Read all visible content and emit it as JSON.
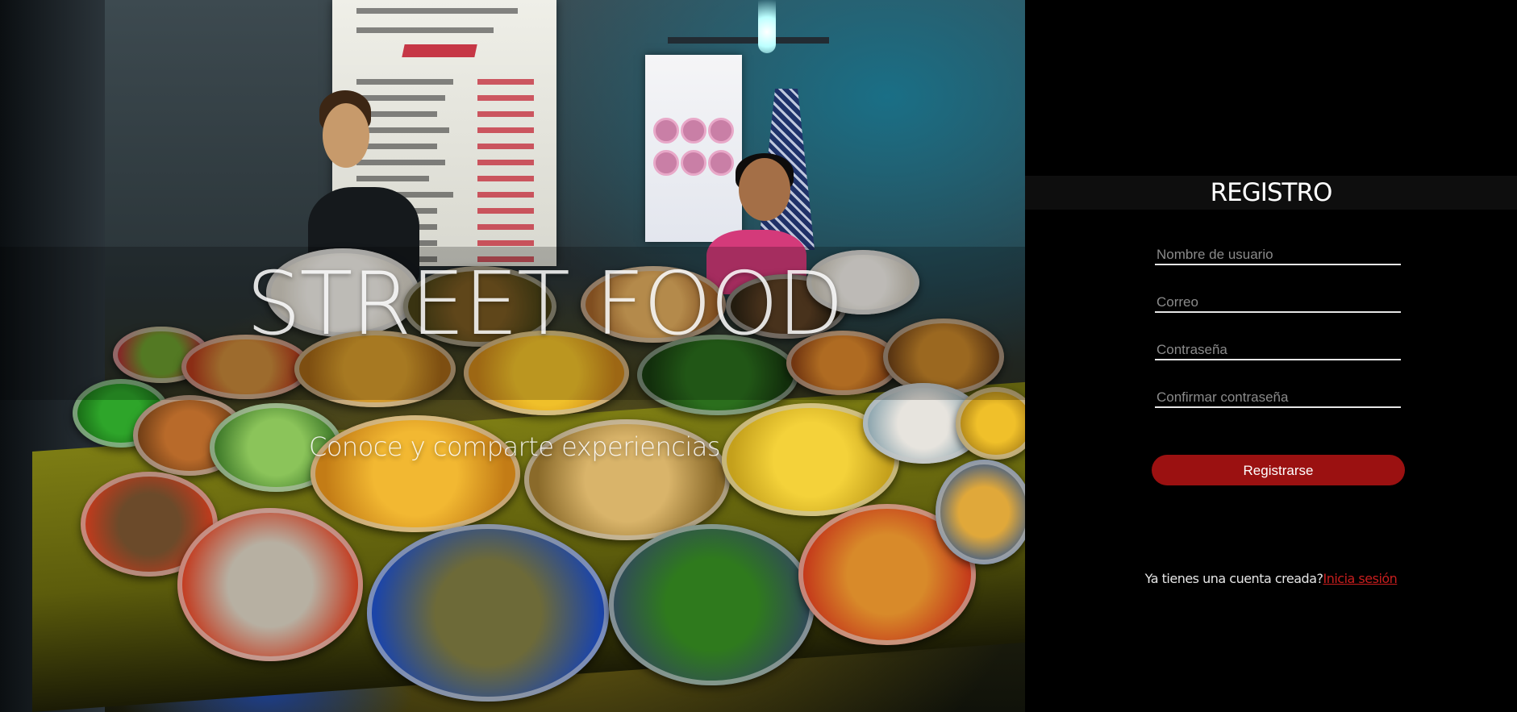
{
  "hero": {
    "title": "STREET FOOD",
    "subtitle": "Conoce y comparte experiencias"
  },
  "register": {
    "title": "REGISTRO",
    "fields": {
      "username": {
        "placeholder": "Nombre de usuario",
        "value": ""
      },
      "email": {
        "placeholder": "Correo",
        "value": ""
      },
      "password": {
        "placeholder": "Contraseña",
        "value": ""
      },
      "confirm_password": {
        "placeholder": "Confirmar contraseña",
        "value": ""
      }
    },
    "submit_label": "Registrarse",
    "login_prompt": "Ya tienes una cuenta creada?",
    "login_link": "Inicia sesión"
  },
  "colors": {
    "accent": "#9b1111",
    "link": "#c81e1e",
    "panel_bg": "#000000"
  }
}
